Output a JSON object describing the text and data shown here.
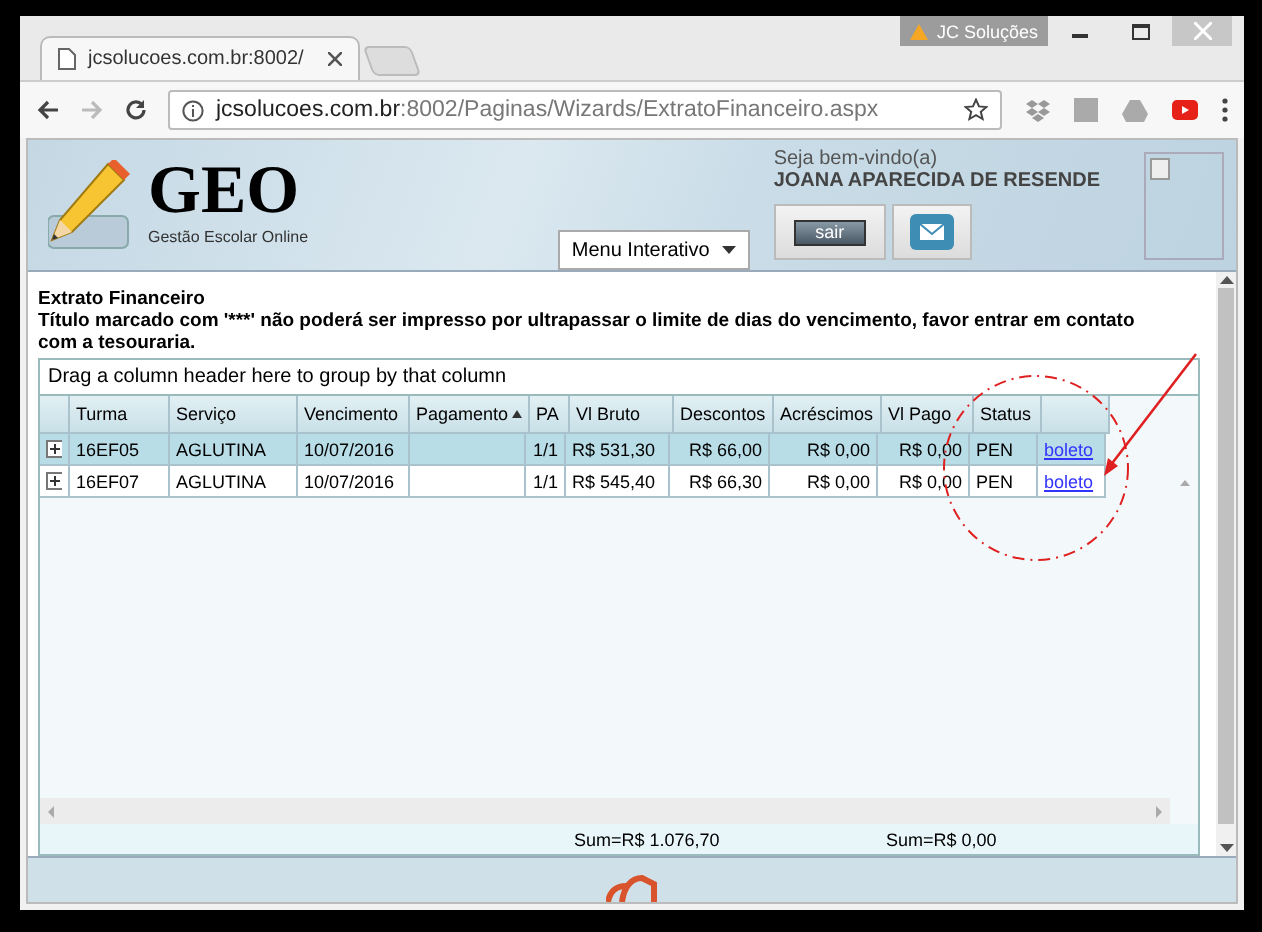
{
  "browser": {
    "tab_title": "jcsolucoes.com.br:8002/",
    "profile": "JC Soluções",
    "url_host": "jcsolucoes.com.br",
    "url_path": ":8002/Paginas/Wizards/ExtratoFinanceiro.aspx"
  },
  "header": {
    "logo": "GEO",
    "logo_subtitle": "Gestão Escolar Online",
    "welcome": "Seja bem-vindo(a)",
    "user": "JOANA APARECIDA DE RESENDE",
    "menu": "Menu Interativo",
    "logout": "sair"
  },
  "content": {
    "title": "Extrato Financeiro",
    "notice": "Título marcado com '***' não poderá ser impresso por ultrapassar o limite de dias do vencimento, favor entrar em contato com a tesouraria."
  },
  "grid": {
    "group_hint": "Drag a column header here to group by that column",
    "columns": [
      {
        "label": "Turma",
        "sorted": false
      },
      {
        "label": "Serviço",
        "sorted": false
      },
      {
        "label": "Vencimento",
        "sorted": false
      },
      {
        "label": "Pagamento",
        "sorted": true
      },
      {
        "label": "PA",
        "sorted": false
      },
      {
        "label": "Vl Bruto",
        "sorted": false,
        "sum": "Sum=R$ 1.076,70"
      },
      {
        "label": "Descontos",
        "sorted": false
      },
      {
        "label": "Acréscimos",
        "sorted": false
      },
      {
        "label": "Vl Pago",
        "sorted": false,
        "sum": "Sum=R$ 0,00"
      },
      {
        "label": "Status",
        "sorted": false
      }
    ],
    "rows": [
      {
        "selected": true,
        "cells": [
          "16EF05",
          "AGLUTINA",
          "10/07/2016",
          null,
          "1/1",
          "R$ 531,30",
          "R$ 66,00",
          "R$ 0,00",
          "R$ 0,00",
          "PEN"
        ],
        "link": "boleto"
      },
      {
        "selected": false,
        "cells": [
          "16EF07",
          "AGLUTINA",
          "10/07/2016",
          null,
          "1/1",
          "R$ 545,40",
          "R$ 66,30",
          "R$ 0,00",
          "R$ 0,00",
          "PEN"
        ],
        "link": "boleto"
      }
    ]
  }
}
